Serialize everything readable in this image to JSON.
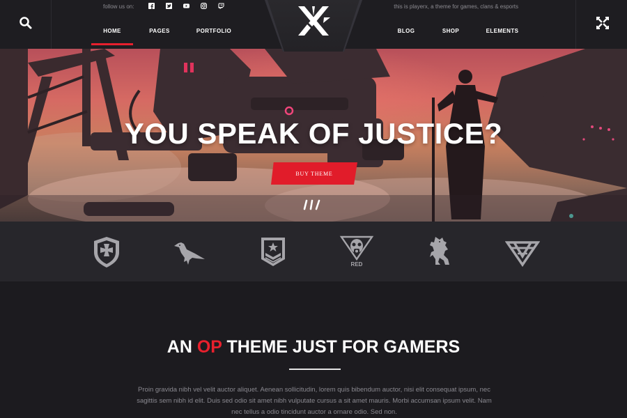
{
  "header": {
    "follow_label": "follow us on:",
    "social_icons": [
      "facebook-icon",
      "twitter-icon",
      "youtube-icon",
      "instagram-icon",
      "twitch-icon"
    ],
    "tagline": "this is playerx, a theme for games, clans & esports",
    "nav_left": [
      "HOME",
      "PAGES",
      "PORTFOLIO"
    ],
    "nav_right": [
      "BLOG",
      "SHOP",
      "ELEMENTS"
    ],
    "active_nav": "HOME"
  },
  "hero": {
    "title": "YOU SPEAK OF JUSTICE?",
    "button_label": "BUY THEME"
  },
  "clans": {
    "icons": [
      "iron-cross-shield-icon",
      "raven-icon",
      "star-chevron-badge-icon",
      "gasmask-skull-icon",
      "lion-crest-icon",
      "triangle-knot-icon"
    ],
    "labels": [
      "",
      "",
      "",
      "RED",
      "",
      ""
    ]
  },
  "intro": {
    "title_before": "AN ",
    "title_highlight": "OP",
    "title_after": " THEME JUST FOR GAMERS",
    "body": "Proin gravida nibh vel velit auctor aliquet. Aenean sollicitudin, lorem quis bibendum auctor, nisi elit consequat ipsum, nec sagittis sem nibh id elit. Duis sed odio sit amet nibh vulputate cursus a sit amet mauris. Morbi accumsan ipsum velit. Nam nec tellus a odio tincidunt auctor a ornare odio. Sed non."
  },
  "colors": {
    "accent": "#e8202d",
    "header_bg": "#1e1d21",
    "strip_bg": "#27262b",
    "page_bg": "#1c1b1f"
  }
}
